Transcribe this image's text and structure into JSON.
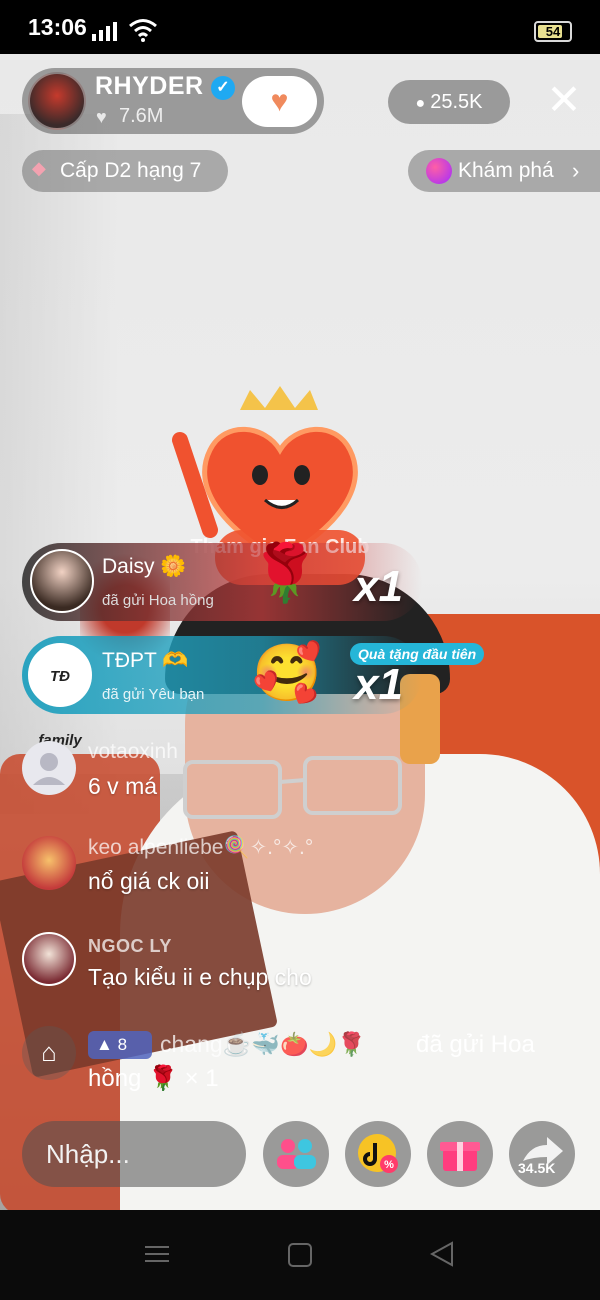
{
  "status_bar": {
    "time": "13:06",
    "battery": "54",
    "icons": [
      "signal-icon",
      "wifi-icon",
      "battery-icon"
    ]
  },
  "header": {
    "host_name": "RHYDER",
    "likes": "7.6M",
    "viewers": "25.5K",
    "rank": "Cấp D2 hạng 7",
    "explore": "Khám phá"
  },
  "overlay": {
    "club_text": "Tham gia Fan Club"
  },
  "gifts": [
    {
      "user": "Daisy 🌼",
      "action": "đã gửi Hoa hồng",
      "emoji": "🌹",
      "count": "x1"
    },
    {
      "user": "TĐPT 🫶",
      "action": "đã gửi Yêu bạn",
      "emoji": "🥰",
      "count": "x1",
      "badge": "Quà tặng đầu tiên",
      "avatar_text": "TĐ family"
    }
  ],
  "comments": [
    {
      "user": "votaoxinh",
      "text": "6 v má"
    },
    {
      "user": "keo alpenliebe🍭✧.°✧.°",
      "text": "nổ giá ck oii"
    },
    {
      "user": "NGOC LY",
      "text": "Tạo kiểu ii e chụp cho"
    },
    {
      "level": "8",
      "user": "chang☕️🐳🍅🌙🌹",
      "text": "đã gửi Hoa",
      "line2": "hồng 🌹 × 1"
    }
  ],
  "bottom_bar": {
    "input_placeholder": "Nhập...",
    "share_count": "34.5K"
  },
  "colors": {
    "verified": "#1fa9f2",
    "gift_banner_teal": "#25b6d8",
    "follow_accent": "#f08a5d"
  }
}
